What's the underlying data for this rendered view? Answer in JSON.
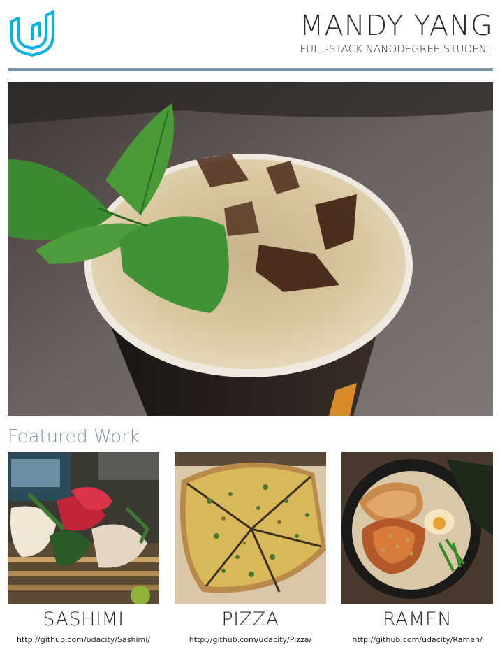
{
  "header": {
    "logo_icon": "udacity-logo-icon",
    "name": "MANDY YANG",
    "subtitle": "FULL-STACK NANODEGREE STUDENT"
  },
  "colors": {
    "accent": "#7d97a7",
    "logo": "#02b3e4",
    "text": "#2b2b2b"
  },
  "hero": {
    "description_icon": "iced-coffee-with-mint-photo"
  },
  "featured": {
    "heading": "Featured Work",
    "items": [
      {
        "title": "SASHIMI",
        "link": "http://github.com/udacity/Sashimi/",
        "image_icon": "sashimi-photo"
      },
      {
        "title": "PIZZA",
        "link": "http://github.com/udacity/Pizza/",
        "image_icon": "pizza-photo"
      },
      {
        "title": "RAMEN",
        "link": "http://github.com/udacity/Ramen/",
        "image_icon": "ramen-photo"
      }
    ]
  }
}
